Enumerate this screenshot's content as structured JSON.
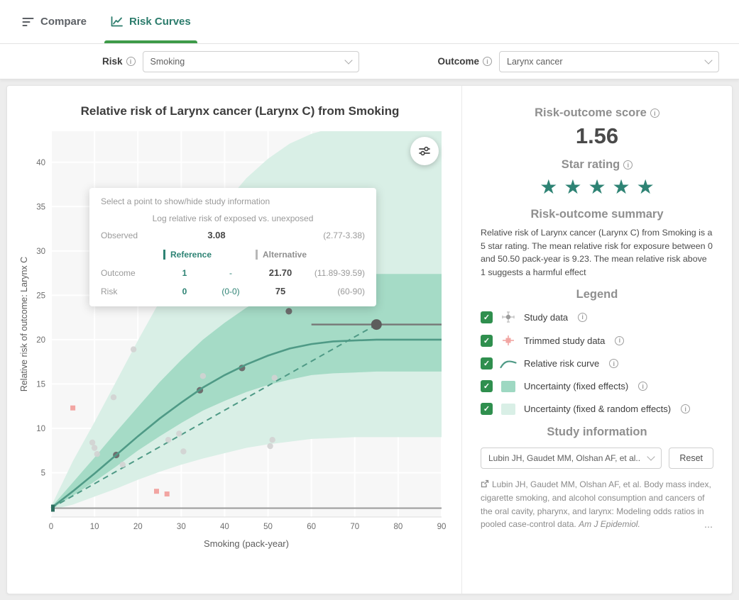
{
  "colors": {
    "teal": "#2e8374",
    "green": "#2f8f4e",
    "curve": "#4f9a86",
    "band_fixed": "#9ed8c2",
    "band_random": "#d9efe6",
    "trimmed": "#f2a5a2"
  },
  "tabs": {
    "compare": "Compare",
    "risk_curves": "Risk Curves"
  },
  "filters": {
    "risk_label": "Risk",
    "risk_value": "Smoking",
    "outcome_label": "Outcome",
    "outcome_value": "Larynx cancer"
  },
  "chart": {
    "title": "Relative risk of Larynx cancer (Larynx C) from Smoking",
    "tooltip": {
      "hint": "Select a point to show/hide study information",
      "subtitle": "Log relative risk of exposed vs. unexposed",
      "observed_label": "Observed",
      "observed_value": "3.08",
      "observed_ci": "(2.77-3.38)",
      "reference_header": "Reference",
      "alternative_header": "Alternative",
      "outcome_label": "Outcome",
      "outcome_ref": "1",
      "outcome_ref_ci": "-",
      "outcome_alt": "21.70",
      "outcome_alt_ci": "(11.89-39.59)",
      "risk_label": "Risk",
      "risk_ref": "0",
      "risk_ref_ci": "(0-0)",
      "risk_alt": "75",
      "risk_alt_ci": "(60-90)"
    }
  },
  "chart_data": {
    "type": "scatter",
    "title": "Relative risk of Larynx cancer (Larynx C) from Smoking",
    "xlabel": "Smoking (pack-year)",
    "ylabel": "Relative risk of outcome: Larynx C",
    "xlim": [
      0,
      90
    ],
    "ylim": [
      0,
      43.5
    ],
    "xticks": [
      0,
      10,
      20,
      30,
      40,
      50,
      60,
      70,
      80,
      90
    ],
    "yticks": [
      5,
      10,
      15,
      20,
      25,
      30,
      35,
      40
    ],
    "curve_x": [
      0,
      5,
      10,
      15,
      20,
      25,
      30,
      35,
      40,
      45,
      50,
      55,
      60,
      65,
      70,
      75,
      80,
      85,
      90
    ],
    "curve_y": [
      1,
      2.9,
      4.9,
      7.0,
      9.1,
      11.1,
      12.9,
      14.6,
      16.0,
      17.2,
      18.2,
      19.0,
      19.5,
      19.8,
      19.9,
      20.0,
      20.0,
      20.0,
      20.0
    ],
    "fixed_lo": [
      0.9,
      2.4,
      4.0,
      5.7,
      7.5,
      9.1,
      10.6,
      12.0,
      13.1,
      14.1,
      14.9,
      15.5,
      16.0,
      16.2,
      16.3,
      16.4,
      16.4,
      16.4,
      16.4
    ],
    "fixed_hi": [
      1.1,
      3.9,
      6.7,
      9.6,
      12.4,
      15.2,
      17.7,
      20.0,
      21.9,
      23.6,
      24.9,
      26.0,
      26.7,
      27.1,
      27.3,
      27.4,
      27.4,
      27.4,
      27.4
    ],
    "random_lo": [
      0.8,
      1.4,
      2.3,
      3.2,
      4.2,
      5.1,
      5.9,
      6.6,
      7.2,
      7.8,
      8.2,
      8.5,
      8.8,
      8.9,
      9.0,
      9.0,
      9.0,
      9.0,
      9.0
    ],
    "random_hi": [
      1.2,
      6.3,
      10.7,
      15.3,
      19.9,
      24.3,
      28.3,
      32.0,
      35.3,
      38.2,
      40.4,
      42.1,
      43.2,
      43.9,
      44.3,
      44.5,
      44.5,
      44.5,
      44.5
    ],
    "dashed_line": {
      "x1": 0,
      "y1": 1,
      "x2": 75,
      "y2": 21.7
    },
    "reference_line_y": 1,
    "selected_point": {
      "x": 75,
      "y": 21.7,
      "xlo": 60,
      "xhi": 90
    },
    "study_points_selected": [
      [
        15,
        7.0
      ],
      [
        34.3,
        14.3
      ],
      [
        44,
        16.8
      ],
      [
        54.8,
        23.2
      ]
    ],
    "study_points_faded": [
      [
        9.5,
        8.4
      ],
      [
        10,
        7.8
      ],
      [
        10.6,
        7.1
      ],
      [
        14.4,
        13.5
      ],
      [
        16.5,
        5.9
      ],
      [
        19,
        18.9
      ],
      [
        27,
        8.7
      ],
      [
        29.5,
        9.4
      ],
      [
        30.5,
        7.4
      ],
      [
        35,
        15.9
      ],
      [
        50.5,
        8.0
      ],
      [
        51,
        8.7
      ],
      [
        51.5,
        15.7
      ]
    ],
    "trimmed_points": [
      [
        5,
        12.3
      ],
      [
        24.3,
        2.9
      ],
      [
        26.7,
        2.6
      ]
    ]
  },
  "side": {
    "score_heading": "Risk-outcome score",
    "score_value": "1.56",
    "star_heading": "Star rating",
    "stars": 5,
    "stars_display": "★★★★★",
    "summary_heading": "Risk-outcome summary",
    "summary_text": "Relative risk of Larynx cancer (Larynx C) from Smoking is a 5 star rating. The mean relative risk for exposure between 0 and 50.50 pack-year is 9.23. The mean relative risk above 1 suggests a harmful effect",
    "legend_heading": "Legend",
    "legend_items": [
      {
        "label": "Study data"
      },
      {
        "label": "Trimmed study data"
      },
      {
        "label": "Relative risk curve"
      },
      {
        "label": "Uncertainty (fixed effects)"
      },
      {
        "label": "Uncertainty (fixed & random effects)"
      }
    ],
    "study_heading": "Study information",
    "study_select_value": "Lubin JH, Gaudet MM, Olshan AF, et al..",
    "reset_label": "Reset",
    "citation_text": "Lubin JH, Gaudet MM, Olshan AF, et al. Body mass index, cigarette smoking, and alcohol consumption and cancers of the oral cavity, pharynx, and larynx: Modeling odds ratios in pooled case-control data.",
    "citation_journal": "Am J Epidemiol.",
    "more_indicator": "⋯"
  }
}
